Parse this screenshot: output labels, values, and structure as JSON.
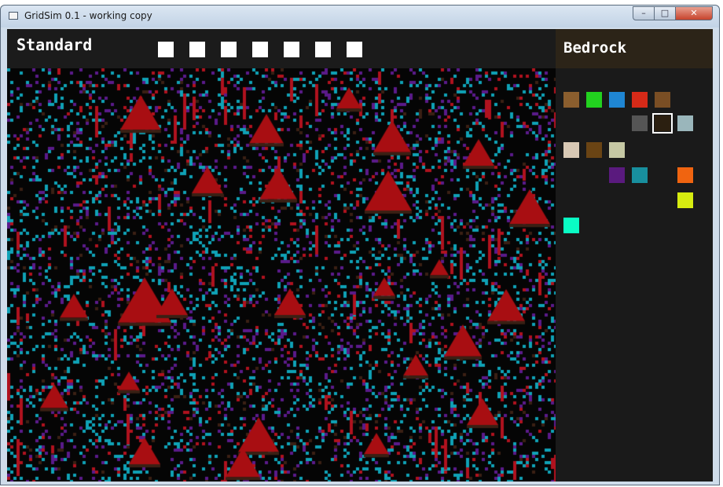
{
  "window": {
    "title": "GridSim 0.1 - working copy",
    "controls": {
      "minimize": "–",
      "maximize": "□",
      "close": "✕"
    }
  },
  "toolbar": {
    "mode_label": "Standard",
    "tool_slot_count": 7,
    "tool_slot_color": "#ffffff"
  },
  "sidebar": {
    "selected_material": "Bedrock",
    "header_color": "#2c2418",
    "palette": [
      {
        "color": "#8b5e2e"
      },
      {
        "color": "#22d11f"
      },
      {
        "color": "#1f86d3"
      },
      {
        "color": "#d62a18"
      },
      {
        "color": "#7a4e24"
      },
      {
        "color": "#555555"
      },
      {
        "color": "#2b1f10",
        "selected": true
      },
      {
        "color": "#9ab6bb"
      },
      {
        "color": "#d8c8b4"
      },
      {
        "color": "#6a4414"
      },
      {
        "color": "#c6c8a4"
      },
      {
        "color": "#5a1a7e"
      },
      {
        "color": "#188f9e"
      },
      {
        "color": "#f06410"
      },
      {
        "color": "#d6ec10"
      },
      {
        "color": "#0afcc4"
      }
    ]
  },
  "simulation": {
    "background": "#050505",
    "particle_colors": [
      "#0fa2b6",
      "#5a1a8a",
      "#b0121e",
      "#3a2014"
    ],
    "mound_color": "#a80e12"
  }
}
